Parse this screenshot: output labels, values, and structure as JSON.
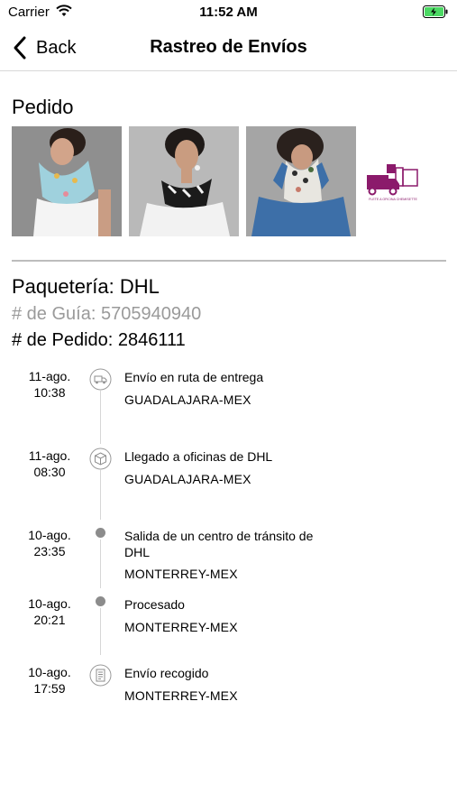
{
  "status_bar": {
    "carrier": "Carrier",
    "time": "11:52 AM"
  },
  "nav": {
    "back_label": "Back",
    "title": "Rastreo de Envíos"
  },
  "order": {
    "section_title": "Pedido",
    "thumbnails": [
      "product-scarf-light-blue",
      "product-scarf-black-white",
      "product-scarf-floral"
    ],
    "delivery_logo_text": "FLETE A OFICINA CHEMISETTE",
    "carrier_line": "Paquetería: DHL",
    "guide_line": "# de Guía: 5705940940",
    "order_line": "# de Pedido: 2846111"
  },
  "timeline": [
    {
      "date": "11-ago.",
      "time": "10:38",
      "icon": "delivery-truck-icon",
      "description": "Envío en ruta de entrega",
      "location": "GUADALAJARA-MEX"
    },
    {
      "date": "11-ago.",
      "time": "08:30",
      "icon": "package-box-icon",
      "description": "Llegado a oficinas de DHL",
      "location": "GUADALAJARA-MEX"
    },
    {
      "date": "10-ago.",
      "time": "23:35",
      "icon": "dot",
      "description": "Salida de un centro de tránsito de DHL",
      "location": "MONTERREY-MEX"
    },
    {
      "date": "10-ago.",
      "time": "20:21",
      "icon": "dot",
      "description": "Procesado",
      "location": "MONTERREY-MEX"
    },
    {
      "date": "10-ago.",
      "time": "17:59",
      "icon": "receipt-icon",
      "description": "Envío recogido",
      "location": "MONTERREY-MEX"
    }
  ],
  "colors": {
    "divider": "#bdbdbd",
    "muted_text": "#9a9a9a",
    "dot": "#8c8c8c",
    "brand_logo": "#8b1a6b",
    "battery_fill": "#4cd964"
  }
}
